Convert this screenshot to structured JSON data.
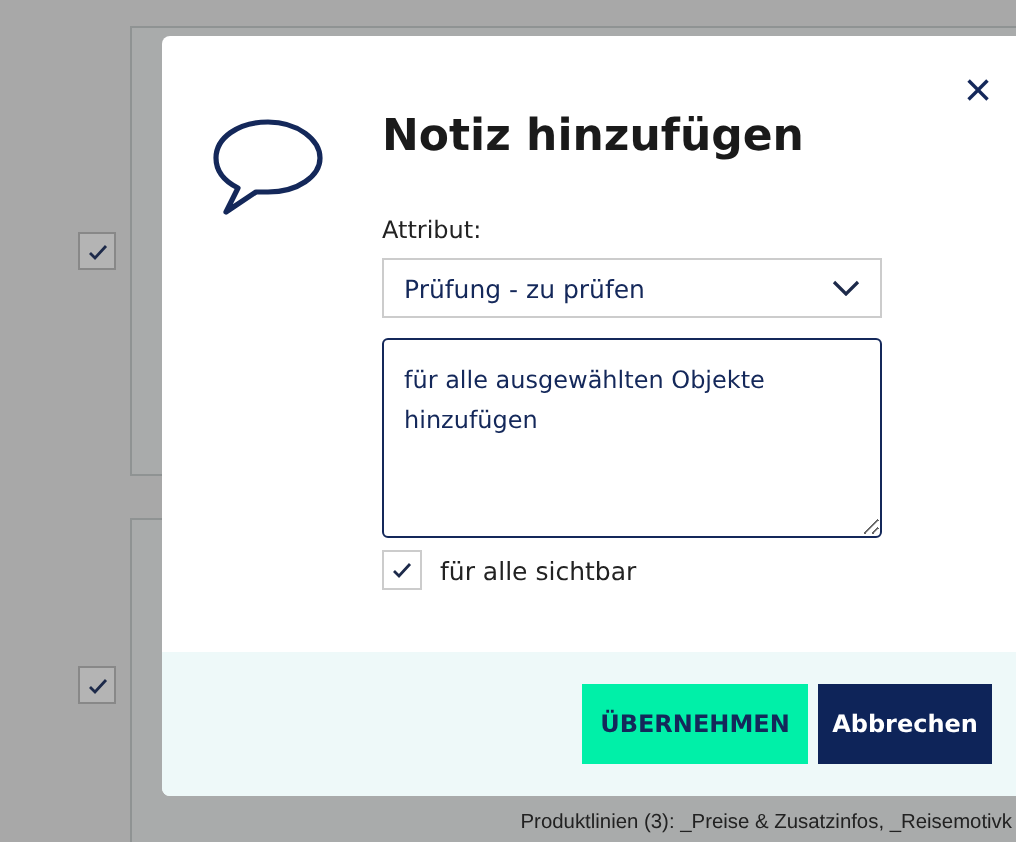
{
  "background": {
    "rows": [
      {
        "checked": true
      },
      {
        "checked": true,
        "text": "Produktlinien (3): _Preise & Zusatzinfos, _Reisemotivk"
      }
    ]
  },
  "dialog": {
    "title": "Notiz hinzufügen",
    "close": "×",
    "attribute_label": "Attribut:",
    "attribute_value": "Prüfung - zu prüfen",
    "note": "für alle ausgewählten Objekte hinzufügen",
    "visible_for_all": {
      "label": "für alle sichtbar",
      "checked": true
    },
    "buttons": [
      {
        "label": "ÜBERNEHMEN",
        "kind": "primary"
      },
      {
        "label": "Abbrechen",
        "kind": "secondary"
      }
    ]
  }
}
